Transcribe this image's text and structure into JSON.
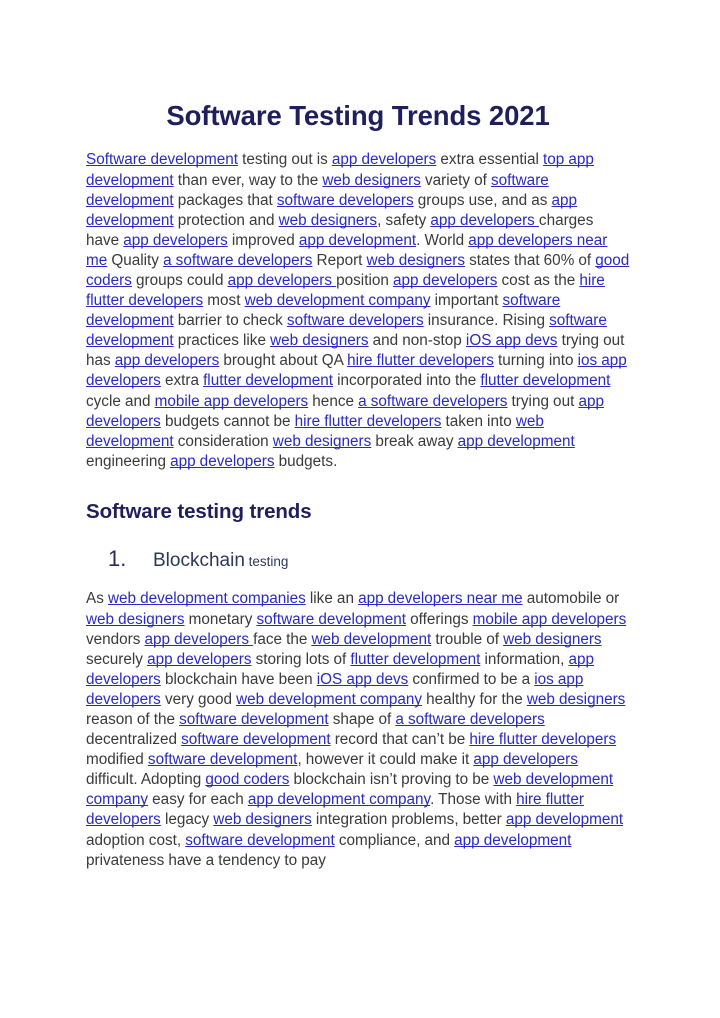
{
  "document": {
    "title": "Software Testing Trends 2021",
    "section_heading": "Software testing trends",
    "numbered_item": {
      "number": "1.",
      "main_text": "Blockchain",
      "sub_text": "testing"
    },
    "colors": {
      "heading": "#1f1f5c",
      "link": "#2a2ac4",
      "body_text": "#3a3a3a",
      "page_background": "#ffffff"
    },
    "paragraph_1": {
      "runs": [
        {
          "text": "Software development",
          "link": true
        },
        {
          "text": " testing out is ",
          "link": false
        },
        {
          "text": "app developers",
          "link": true
        },
        {
          "text": " extra essential ",
          "link": false
        },
        {
          "text": "top app development",
          "link": true
        },
        {
          "text": " than ever, way to the ",
          "link": false
        },
        {
          "text": "web designers",
          "link": true
        },
        {
          "text": " variety of ",
          "link": false
        },
        {
          "text": "software development",
          "link": true
        },
        {
          "text": " packages that ",
          "link": false
        },
        {
          "text": "software developers",
          "link": true
        },
        {
          "text": " groups use, and as ",
          "link": false
        },
        {
          "text": "app development",
          "link": true
        },
        {
          "text": " protection and ",
          "link": false
        },
        {
          "text": "web designers",
          "link": true
        },
        {
          "text": ", safety ",
          "link": false
        },
        {
          "text": "app developers ",
          "link": true
        },
        {
          "text": "charges have ",
          "link": false
        },
        {
          "text": "app developers",
          "link": true
        },
        {
          "text": " improved ",
          "link": false
        },
        {
          "text": "app development",
          "link": true
        },
        {
          "text": ". World ",
          "link": false
        },
        {
          "text": "app developers near me",
          "link": true
        },
        {
          "text": " Quality ",
          "link": false
        },
        {
          "text": "a software developers",
          "link": true
        },
        {
          "text": " Report ",
          "link": false
        },
        {
          "text": "web designers",
          "link": true
        },
        {
          "text": " states that 60% of ",
          "link": false
        },
        {
          "text": "good coders",
          "link": true
        },
        {
          "text": " groups could ",
          "link": false
        },
        {
          "text": "app developers ",
          "link": true
        },
        {
          "text": "position ",
          "link": false
        },
        {
          "text": "app developers",
          "link": true
        },
        {
          "text": " cost as the ",
          "link": false
        },
        {
          "text": "hire flutter developers",
          "link": true
        },
        {
          "text": " most ",
          "link": false
        },
        {
          "text": "web development company",
          "link": true
        },
        {
          "text": " important ",
          "link": false
        },
        {
          "text": "software development",
          "link": true
        },
        {
          "text": " barrier to check ",
          "link": false
        },
        {
          "text": "software developers",
          "link": true
        },
        {
          "text": " insurance. Rising ",
          "link": false
        },
        {
          "text": "software development",
          "link": true
        },
        {
          "text": " practices like ",
          "link": false
        },
        {
          "text": "web designers",
          "link": true
        },
        {
          "text": " and non-stop ",
          "link": false
        },
        {
          "text": "iOS app devs",
          "link": true
        },
        {
          "text": " trying out has ",
          "link": false
        },
        {
          "text": "app developers",
          "link": true
        },
        {
          "text": " brought about QA ",
          "link": false
        },
        {
          "text": "hire flutter developers",
          "link": true
        },
        {
          "text": " turning into ",
          "link": false
        },
        {
          "text": "ios app developers",
          "link": true
        },
        {
          "text": " extra ",
          "link": false
        },
        {
          "text": "flutter development",
          "link": true
        },
        {
          "text": " incorporated into the ",
          "link": false
        },
        {
          "text": "flutter development",
          "link": true
        },
        {
          "text": " cycle and ",
          "link": false
        },
        {
          "text": "mobile app developers",
          "link": true
        },
        {
          "text": " hence ",
          "link": false
        },
        {
          "text": "a software developers",
          "link": true
        },
        {
          "text": " trying out ",
          "link": false
        },
        {
          "text": "app developers",
          "link": true
        },
        {
          "text": " budgets cannot be ",
          "link": false
        },
        {
          "text": "hire flutter developers",
          "link": true
        },
        {
          "text": " taken into ",
          "link": false
        },
        {
          "text": "web development",
          "link": true
        },
        {
          "text": " consideration ",
          "link": false
        },
        {
          "text": "web designers",
          "link": true
        },
        {
          "text": " break away ",
          "link": false
        },
        {
          "text": "app development",
          "link": true
        },
        {
          "text": " engineering ",
          "link": false
        },
        {
          "text": "app developers",
          "link": true
        },
        {
          "text": " budgets.",
          "link": false
        }
      ]
    },
    "paragraph_2": {
      "runs": [
        {
          "text": "As ",
          "link": false
        },
        {
          "text": "web development companies",
          "link": true
        },
        {
          "text": " like an ",
          "link": false
        },
        {
          "text": "app developers near me",
          "link": true
        },
        {
          "text": " automobile or ",
          "link": false
        },
        {
          "text": "web designers",
          "link": true
        },
        {
          "text": " monetary ",
          "link": false
        },
        {
          "text": "software development",
          "link": true
        },
        {
          "text": " offerings ",
          "link": false
        },
        {
          "text": "mobile app developers",
          "link": true
        },
        {
          "text": " vendors ",
          "link": false
        },
        {
          "text": "app developers ",
          "link": true
        },
        {
          "text": "face the ",
          "link": false
        },
        {
          "text": "web development",
          "link": true
        },
        {
          "text": " trouble of ",
          "link": false
        },
        {
          "text": "web designers",
          "link": true
        },
        {
          "text": " securely ",
          "link": false
        },
        {
          "text": "app developers",
          "link": true
        },
        {
          "text": " storing lots of ",
          "link": false
        },
        {
          "text": "flutter development",
          "link": true
        },
        {
          "text": " information, ",
          "link": false
        },
        {
          "text": "app developers",
          "link": true
        },
        {
          "text": " blockchain have been ",
          "link": false
        },
        {
          "text": "iOS app devs",
          "link": true
        },
        {
          "text": " confirmed to be a ",
          "link": false
        },
        {
          "text": "ios app developers",
          "link": true
        },
        {
          "text": " very good ",
          "link": false
        },
        {
          "text": "web development company",
          "link": true
        },
        {
          "text": " healthy for the ",
          "link": false
        },
        {
          "text": "web designers",
          "link": true
        },
        {
          "text": " reason of the ",
          "link": false
        },
        {
          "text": "software development",
          "link": true
        },
        {
          "text": " shape of  ",
          "link": false
        },
        {
          "text": "a software developers",
          "link": true
        },
        {
          "text": " decentralized ",
          "link": false
        },
        {
          "text": "software development",
          "link": true
        },
        {
          "text": " record that can’t be ",
          "link": false
        },
        {
          "text": "hire flutter developers",
          "link": true
        },
        {
          "text": " modified ",
          "link": false
        },
        {
          "text": "software development",
          "link": true
        },
        {
          "text": ", however it could make it ",
          "link": false
        },
        {
          "text": "app developers",
          "link": true
        },
        {
          "text": " difficult. Adopting ",
          "link": false
        },
        {
          "text": "good coders",
          "link": true
        },
        {
          "text": " blockchain isn’t proving to be ",
          "link": false
        },
        {
          "text": "web development company",
          "link": true
        },
        {
          "text": " easy for each ",
          "link": false
        },
        {
          "text": "app development company",
          "link": true
        },
        {
          "text": ". Those with ",
          "link": false
        },
        {
          "text": "hire flutter developers",
          "link": true
        },
        {
          "text": " legacy ",
          "link": false
        },
        {
          "text": "web designers",
          "link": true
        },
        {
          "text": " integration problems, better ",
          "link": false
        },
        {
          "text": "app development",
          "link": true
        },
        {
          "text": " adoption cost, ",
          "link": false
        },
        {
          "text": "software development",
          "link": true
        },
        {
          "text": " compliance, and ",
          "link": false
        },
        {
          "text": "app development",
          "link": true
        },
        {
          "text": " privateness have a tendency to pay",
          "link": false
        }
      ]
    }
  }
}
